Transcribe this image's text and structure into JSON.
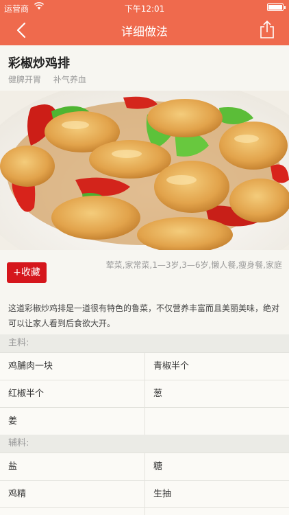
{
  "status_bar": {
    "carrier": "运营商",
    "time": "下午12:01"
  },
  "nav": {
    "title": "详细做法",
    "back_icon": "chevron-left-icon",
    "share_icon": "share-icon"
  },
  "recipe": {
    "name": "彩椒炒鸡排",
    "tags": [
      "健脾开胃",
      "补气养血"
    ],
    "categories": "荤菜,家常菜,1—3岁,3—6岁,懒人餐,瘦身餐,家庭",
    "favorite_label": "+收藏",
    "description": "这道彩椒炒鸡排是一道很有特色的鲁菜，不仅营养丰富而且美丽美味，绝对可以让家人看到后食欲大开。"
  },
  "main_ingredients": {
    "title": "主料:",
    "rows": [
      [
        "鸡脯肉一块",
        "青椒半个"
      ],
      [
        "红椒半个",
        "葱"
      ],
      [
        "姜",
        ""
      ]
    ]
  },
  "aux_ingredients": {
    "title": "辅料:",
    "rows": [
      [
        "盐",
        "糖"
      ],
      [
        "鸡精",
        "生抽"
      ],
      [
        "",
        ""
      ]
    ]
  },
  "colors": {
    "header": "#ef6a4d",
    "favorite": "#d5161c"
  }
}
